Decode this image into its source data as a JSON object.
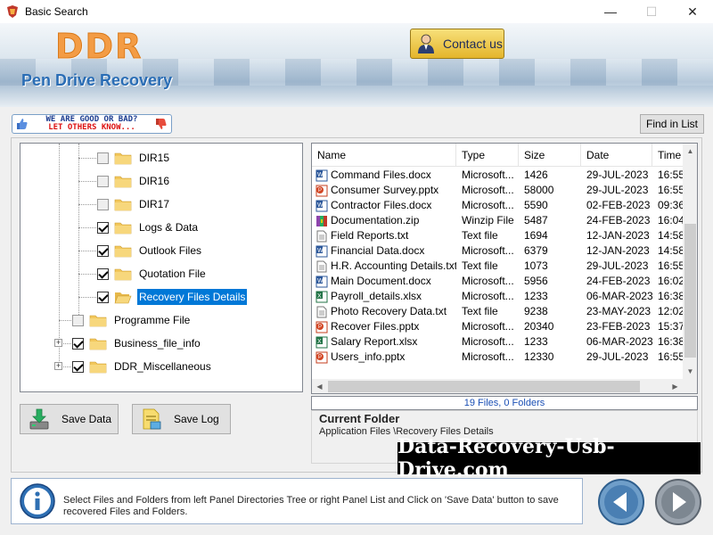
{
  "window": {
    "title": "Basic Search",
    "minimize": "—",
    "maximize": "☐",
    "close": "✕"
  },
  "banner": {
    "logo": "DDR",
    "subtitle": "Pen Drive Recovery",
    "contact_label": "Contact us"
  },
  "toolbar": {
    "good_bad_line1": "WE ARE GOOD OR BAD?",
    "good_bad_line2": "LET OTHERS KNOW...",
    "find_in_list": "Find in List"
  },
  "tree": {
    "items": [
      {
        "label": "DIR15",
        "checked": false,
        "selected": false
      },
      {
        "label": "DIR16",
        "checked": false,
        "selected": false
      },
      {
        "label": "DIR17",
        "checked": false,
        "selected": false
      },
      {
        "label": "Logs & Data",
        "checked": true,
        "selected": false
      },
      {
        "label": "Outlook Files",
        "checked": true,
        "selected": false
      },
      {
        "label": "Quotation File",
        "checked": true,
        "selected": false
      },
      {
        "label": "Recovery Files Details",
        "checked": true,
        "selected": true
      },
      {
        "label": "Programme File",
        "checked": false,
        "selected": false
      },
      {
        "label": "Business_file_info",
        "checked": true,
        "selected": false
      },
      {
        "label": "DDR_Miscellaneous",
        "checked": true,
        "selected": false
      }
    ]
  },
  "list": {
    "columns": [
      "Name",
      "Type",
      "Size",
      "Date",
      "Time"
    ],
    "rows": [
      {
        "icon": "word",
        "name": "Command Files.docx",
        "type": "Microsoft...",
        "size": "1426",
        "date": "29-JUL-2023",
        "time": "16:55"
      },
      {
        "icon": "ppt",
        "name": "Consumer Survey.pptx",
        "type": "Microsoft...",
        "size": "58000",
        "date": "29-JUL-2023",
        "time": "16:55"
      },
      {
        "icon": "word",
        "name": "Contractor Files.docx",
        "type": "Microsoft...",
        "size": "5590",
        "date": "02-FEB-2023",
        "time": "09:36"
      },
      {
        "icon": "zip",
        "name": "Documentation.zip",
        "type": "Winzip File",
        "size": "5487",
        "date": "24-FEB-2023",
        "time": "16:04"
      },
      {
        "icon": "text",
        "name": "Field Reports.txt",
        "type": "Text file",
        "size": "1694",
        "date": "12-JAN-2023",
        "time": "14:58"
      },
      {
        "icon": "word",
        "name": "Financial Data.docx",
        "type": "Microsoft...",
        "size": "6379",
        "date": "12-JAN-2023",
        "time": "14:58"
      },
      {
        "icon": "text",
        "name": "H.R. Accounting Details.txt",
        "type": "Text file",
        "size": "1073",
        "date": "29-JUL-2023",
        "time": "16:55"
      },
      {
        "icon": "word",
        "name": "Main Document.docx",
        "type": "Microsoft...",
        "size": "5956",
        "date": "24-FEB-2023",
        "time": "16:02"
      },
      {
        "icon": "excel",
        "name": "Payroll_details.xlsx",
        "type": "Microsoft...",
        "size": "1233",
        "date": "06-MAR-2023",
        "time": "16:38"
      },
      {
        "icon": "text",
        "name": "Photo Recovery Data.txt",
        "type": "Text file",
        "size": "9238",
        "date": "23-MAY-2023",
        "time": "12:02"
      },
      {
        "icon": "ppt",
        "name": "Recover Files.pptx",
        "type": "Microsoft...",
        "size": "20340",
        "date": "23-FEB-2023",
        "time": "15:37"
      },
      {
        "icon": "excel",
        "name": "Salary Report.xlsx",
        "type": "Microsoft...",
        "size": "1233",
        "date": "06-MAR-2023",
        "time": "16:38"
      },
      {
        "icon": "ppt",
        "name": "Users_info.pptx",
        "type": "Microsoft...",
        "size": "12330",
        "date": "29-JUL-2023",
        "time": "16:55"
      }
    ],
    "status": "19 Files, 0 Folders"
  },
  "current_folder": {
    "heading": "Current Folder",
    "path": "Application Files \\Recovery Files Details"
  },
  "watermark": "Data-Recovery-Usb-Drive.com",
  "actions": {
    "save_data": "Save Data",
    "save_log": "Save Log"
  },
  "bottom": {
    "text": "Select Files and Folders from left Panel Directories Tree or right Panel List and Click on 'Save Data' button to save recovered Files and Folders."
  },
  "icons": {
    "app": "app-icon",
    "contact": "person-icon",
    "folder": "folder-icon",
    "info": "info-icon",
    "back": "back-arrow-icon",
    "next": "next-arrow-icon"
  },
  "colors": {
    "selection": "#0078d7",
    "banner_subtitle": "#2a6db5",
    "logo": "#f39c45",
    "contact_button": "#e4b52b",
    "status_text": "#1a4fb5"
  }
}
